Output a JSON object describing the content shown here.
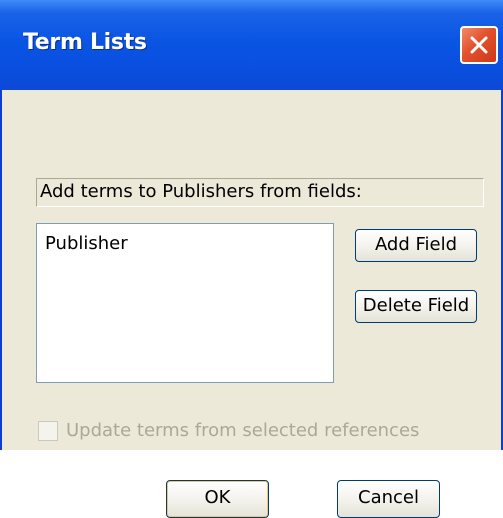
{
  "window": {
    "title": "Term Lists"
  },
  "dialog": {
    "instruction": "Add terms to Publishers from fields:",
    "fields_list": [
      "Publisher"
    ],
    "add_field_label": "Add Field",
    "delete_field_label": "Delete Field",
    "update_checkbox": {
      "label": "Update terms from selected references",
      "checked": false,
      "enabled": false
    },
    "ok_label": "OK",
    "cancel_label": "Cancel"
  },
  "colors": {
    "titlebar": "#0a55e3",
    "close_button": "#e2502c",
    "dialog_background": "#ece9d8",
    "disabled_text": "#aca899"
  },
  "icons": {
    "close": "close-x-icon"
  }
}
